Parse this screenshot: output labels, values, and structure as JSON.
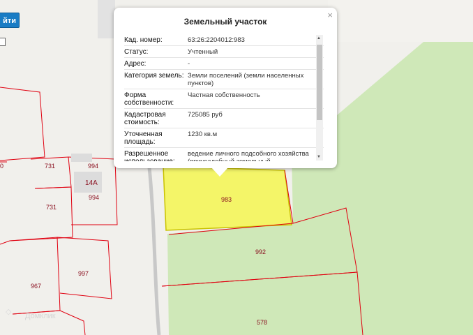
{
  "toolbar": {
    "find_button_label": "йти"
  },
  "map": {
    "parcel_labels": {
      "p983": "983",
      "p992": "992",
      "p578": "578",
      "p731a": "731",
      "p731b": "731",
      "p994a": "994",
      "p994b": "994",
      "p997": "997",
      "p967": "967",
      "p0": "0"
    },
    "house_number": "14А",
    "watermark_text": "Домклик",
    "colors": {
      "selected_fill": "#f4f55a",
      "selected_stroke": "#c9c200",
      "parcel_stroke": "#e00010",
      "green_area": "#cfe8b8"
    }
  },
  "popup": {
    "title": "Земельный участок",
    "close_symbol": "×",
    "rows": [
      {
        "label": "Кад. номер:",
        "value": "63:26:2204012:983"
      },
      {
        "label": "Статус:",
        "value": "Учтенный"
      },
      {
        "label": "Адрес:",
        "value": "-"
      },
      {
        "label": "Категория земель:",
        "value": "Земли поселений (земли населенных пунктов)"
      },
      {
        "label": "Форма собственности:",
        "value": "Частная собственность"
      },
      {
        "label": "Кадастровая стоимость:",
        "value": "725085 руб"
      },
      {
        "label": "Уточненная площадь:",
        "value": "1230 кв.м"
      },
      {
        "label": "Разрешенное использование:",
        "value": "ведение личного подсобного хозяйства (приусадебный земельный"
      }
    ]
  }
}
